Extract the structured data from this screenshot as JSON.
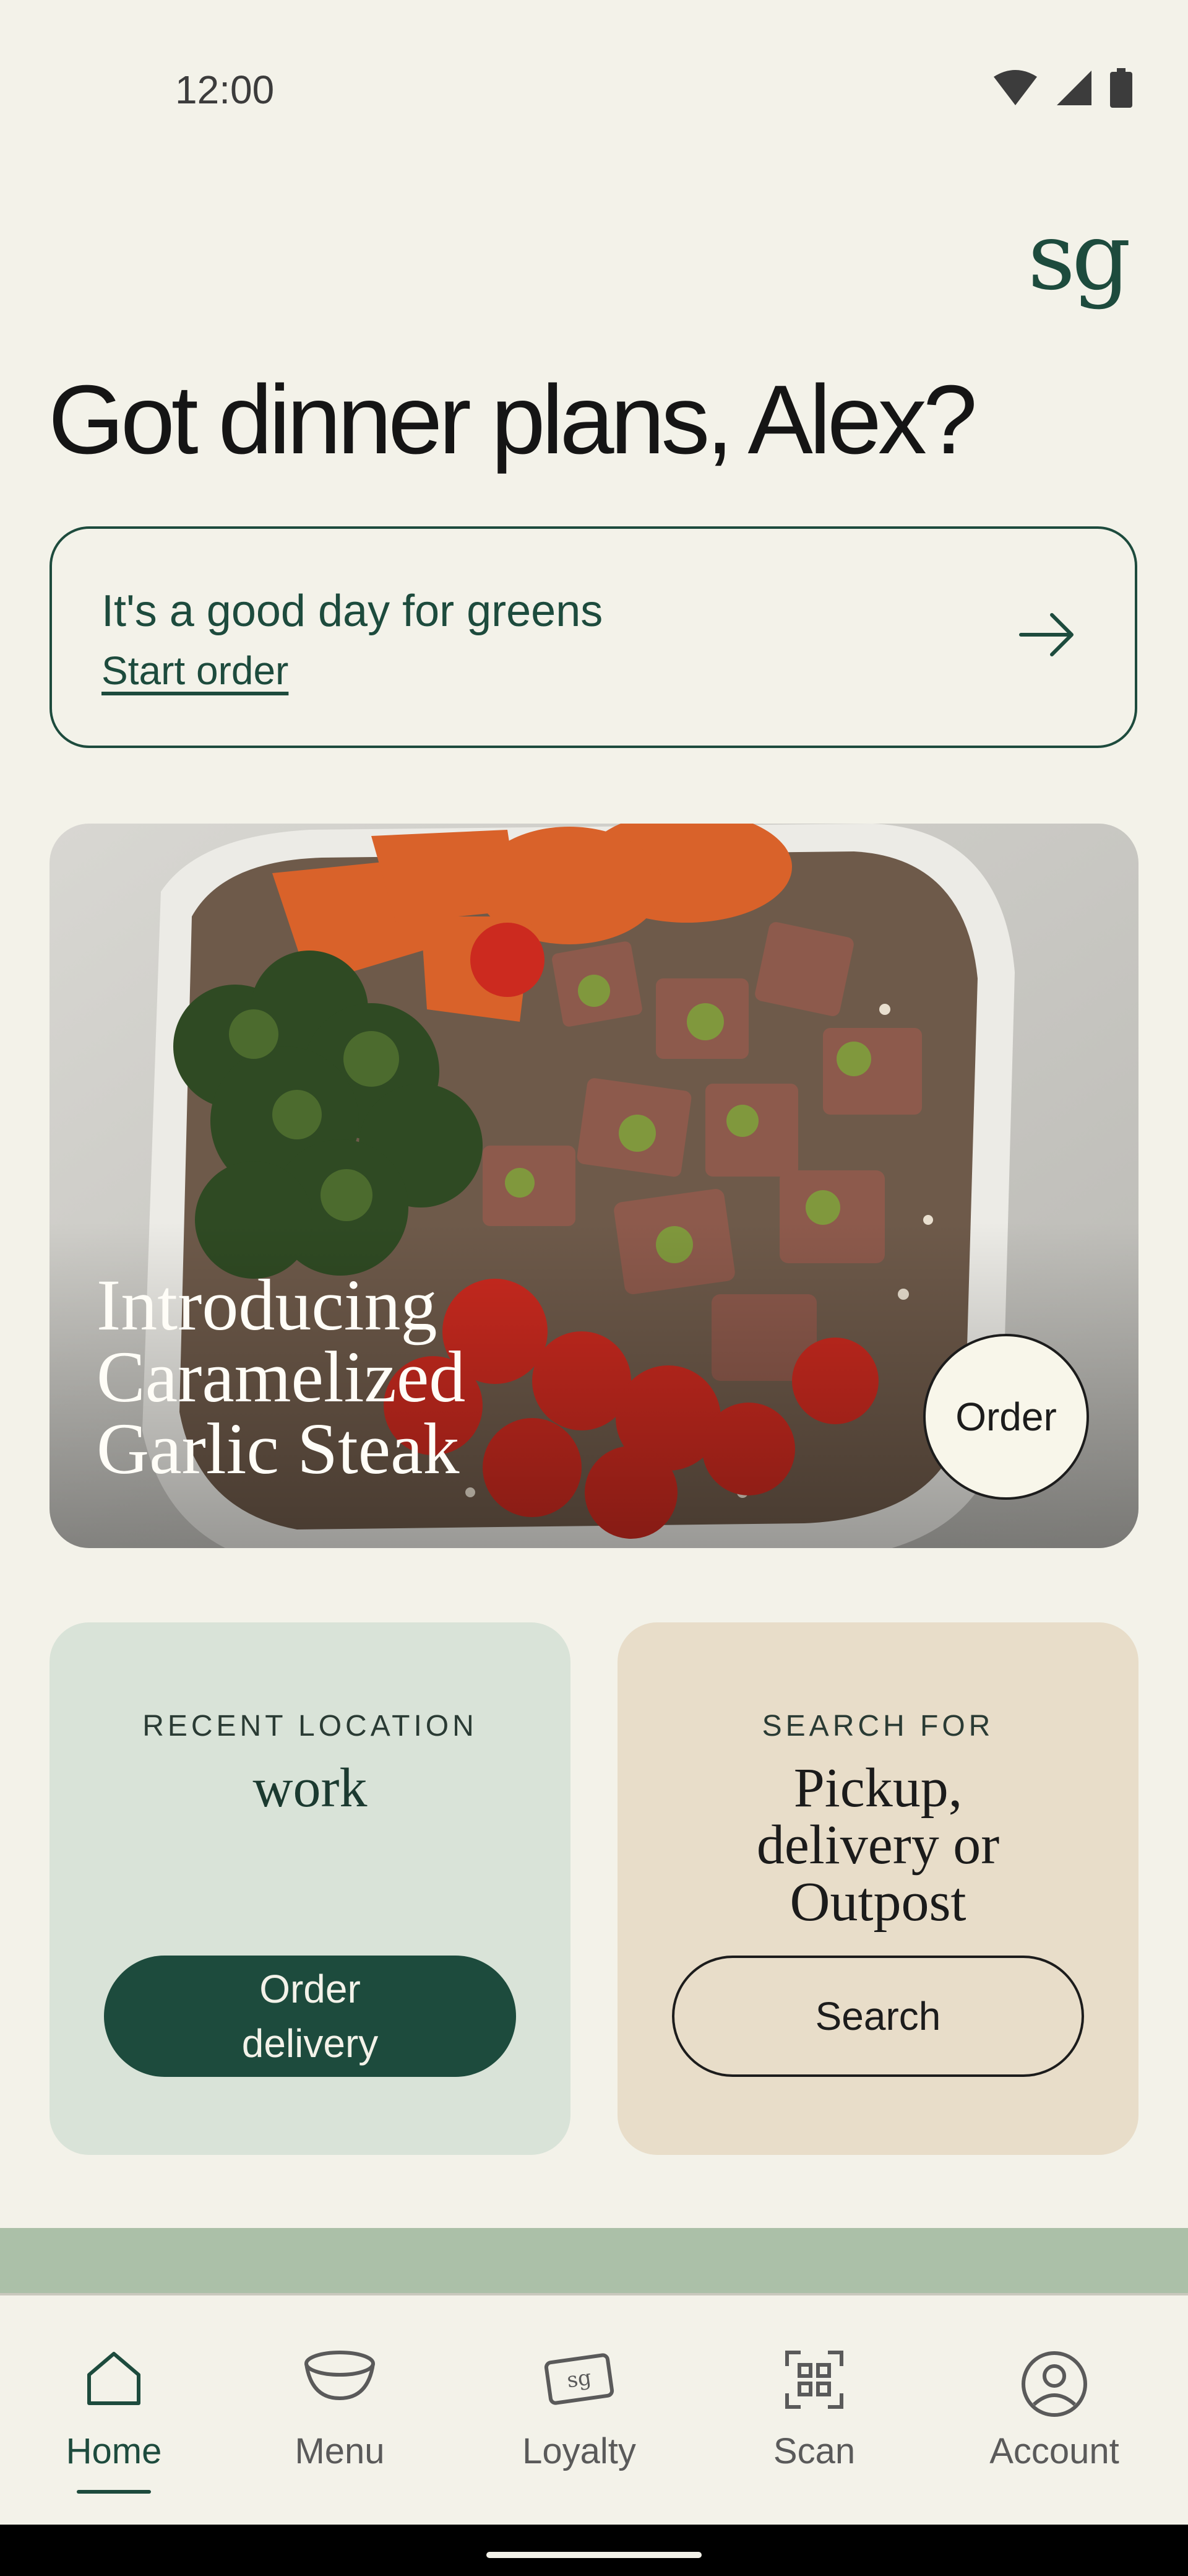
{
  "status_bar": {
    "time": "12:00"
  },
  "brand": {
    "logo_text": "sg",
    "accent": "#1d4b3d"
  },
  "greeting": "Got dinner plans, Alex?",
  "order_card": {
    "title": "It's a good day for greens",
    "link": "Start order"
  },
  "hero": {
    "title": "Introducing\nCaramelized\nGarlic Steak",
    "order_label": "Order"
  },
  "tiles": {
    "recent": {
      "kicker": "RECENT LOCATION",
      "title": "work",
      "button": "Order\ndelivery"
    },
    "search": {
      "kicker": "SEARCH FOR",
      "title": "Pickup, delivery or Outpost",
      "button": "Search"
    }
  },
  "nav": {
    "items": [
      {
        "label": "Home",
        "icon": "home-icon",
        "active": true
      },
      {
        "label": "Menu",
        "icon": "bowl-icon",
        "active": false
      },
      {
        "label": "Loyalty",
        "icon": "loyalty-card-icon",
        "active": false
      },
      {
        "label": "Scan",
        "icon": "qr-scan-icon",
        "active": false
      },
      {
        "label": "Account",
        "icon": "account-icon",
        "active": false
      }
    ]
  }
}
